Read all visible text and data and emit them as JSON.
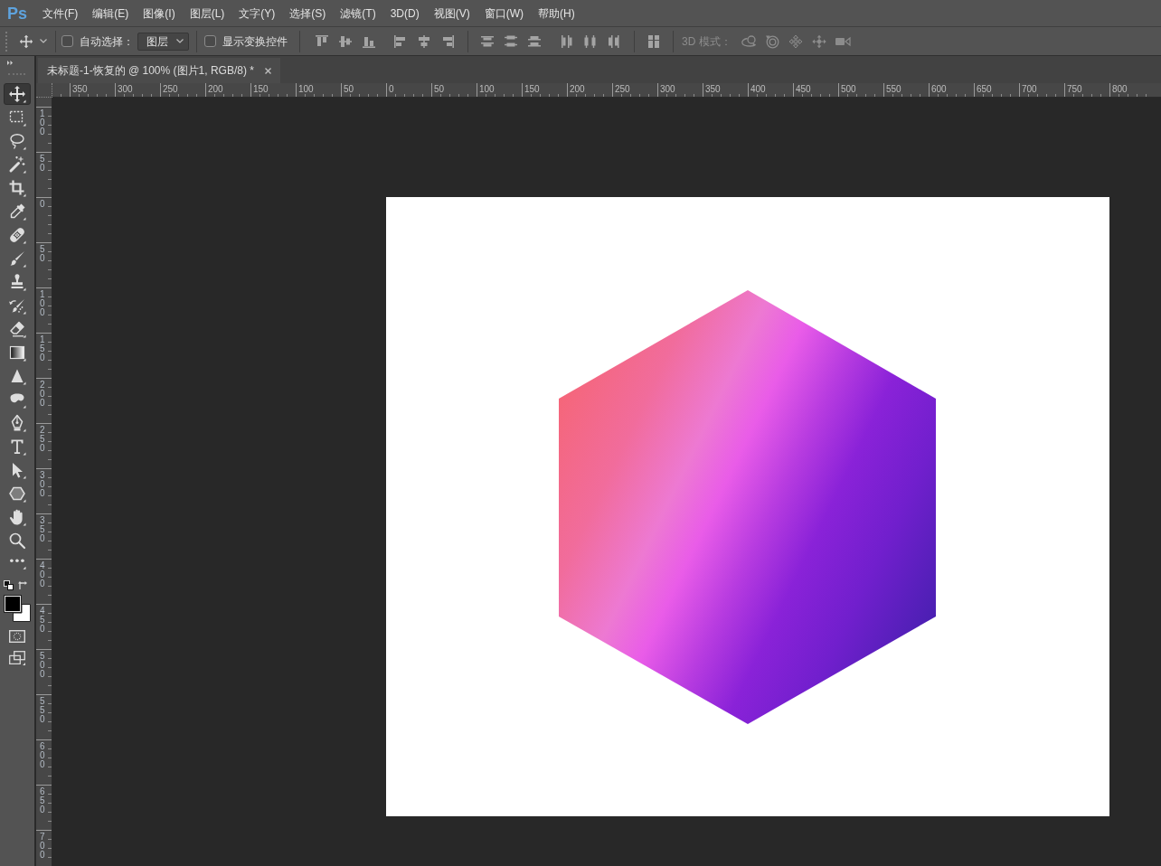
{
  "menubar": {
    "logo": "Ps",
    "items": [
      "文件(F)",
      "编辑(E)",
      "图像(I)",
      "图层(L)",
      "文字(Y)",
      "选择(S)",
      "滤镜(T)",
      "3D(D)",
      "视图(V)",
      "窗口(W)",
      "帮助(H)"
    ]
  },
  "options_bar": {
    "auto_select": {
      "label": "自动选择：",
      "checked": false
    },
    "auto_select_target": {
      "value": "图层"
    },
    "show_transform_controls": {
      "label": "显示变换控件",
      "checked": false
    },
    "three_d_mode": {
      "label": "3D 模式：",
      "disabled": true
    }
  },
  "tools": [
    {
      "kind": "move",
      "selected": true
    },
    {
      "kind": "marquee",
      "selected": false
    },
    {
      "kind": "lasso",
      "selected": false
    },
    {
      "kind": "wand",
      "selected": false
    },
    {
      "kind": "crop",
      "selected": false
    },
    {
      "kind": "eyedropper",
      "selected": false
    },
    {
      "kind": "bandage",
      "selected": false
    },
    {
      "kind": "brush",
      "selected": false
    },
    {
      "kind": "stamp",
      "selected": false
    },
    {
      "kind": "history",
      "selected": false
    },
    {
      "kind": "eraser",
      "selected": false
    },
    {
      "kind": "gradient",
      "selected": false
    },
    {
      "kind": "blur",
      "selected": false
    },
    {
      "kind": "dodge",
      "selected": false
    },
    {
      "kind": "pen",
      "selected": false
    },
    {
      "kind": "type",
      "selected": false
    },
    {
      "kind": "path",
      "selected": false
    },
    {
      "kind": "shape",
      "selected": false
    },
    {
      "kind": "hand",
      "selected": false
    },
    {
      "kind": "zoom",
      "selected": false
    },
    {
      "kind": "more",
      "selected": false
    }
  ],
  "swatches": [
    {
      "kind": "background",
      "color": "#ffffff"
    },
    {
      "kind": "foreground",
      "color": "#000000"
    }
  ],
  "document_tab": {
    "title": "未标题-1-恢复的 @ 100% (图片1, RGB/8) *",
    "selected": true
  },
  "rulers": {
    "horizontal": [
      "350",
      "300",
      "250",
      "200",
      "150",
      "100",
      "50",
      "0",
      "50",
      "100",
      "150",
      "200",
      "250",
      "300",
      "350",
      "400",
      "450",
      "500",
      "550",
      "600",
      "650",
      "700",
      "750",
      "800"
    ],
    "vertical": [
      "100",
      "50",
      "0",
      "50",
      "100",
      "150",
      "200",
      "250",
      "300",
      "350",
      "400",
      "450",
      "500",
      "550",
      "600",
      "650",
      "700"
    ]
  }
}
